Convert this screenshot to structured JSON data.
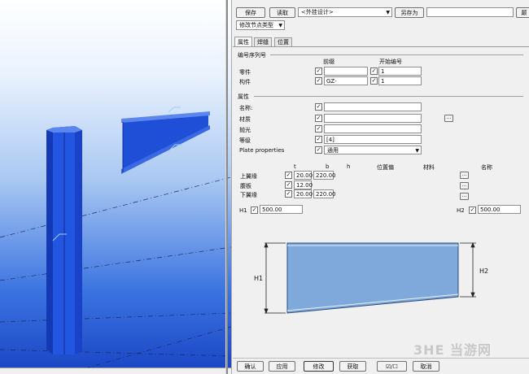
{
  "toolbar": {
    "save_label": "保存",
    "read_label": "读取",
    "preset_value": "<外挂设计>",
    "save_as_label": "另存为",
    "saveas_name_value": "",
    "third_button_label": "颠"
  },
  "mode_select": {
    "value": "修改节点类型"
  },
  "tabs": [
    {
      "label": "属性",
      "active": true
    },
    {
      "label": "焊缝",
      "active": false
    },
    {
      "label": "位置",
      "active": false
    }
  ],
  "numbering": {
    "section_title": "编号序列号",
    "prefix_header": "前缀",
    "start_header": "开始编号",
    "rows": [
      {
        "label": "零件",
        "prefix": "",
        "start": "1"
      },
      {
        "label": "构件",
        "prefix": "GZ-",
        "start": "1"
      }
    ]
  },
  "attributes": {
    "section_title": "属性",
    "rows": [
      {
        "label": "名称:",
        "value": ""
      },
      {
        "label": "材质",
        "value": ""
      },
      {
        "label": "抛光",
        "value": ""
      },
      {
        "label": "等级",
        "value": "[4]"
      },
      {
        "label": "Plate properties",
        "value": "通用"
      }
    ]
  },
  "profile": {
    "headers": {
      "t": "t",
      "b": "b",
      "h": "h",
      "offset": "位置偏",
      "material": "材料",
      "name": "名称"
    },
    "rows": [
      {
        "label": "上翼缘",
        "t": "20.00",
        "b": "220.00"
      },
      {
        "label": "腹板",
        "t": "12.00",
        "b": ""
      },
      {
        "label": "下翼缘",
        "t": "20.00",
        "b": "220.00"
      }
    ],
    "h1_label": "H1",
    "h1_value": "500.00",
    "h2_label": "H2",
    "h2_value": "500.00"
  },
  "diagram": {
    "h1_label": "H1",
    "h2_label": "H2"
  },
  "bottom_buttons": {
    "ok": "确认",
    "apply": "应用",
    "modify": "修改",
    "get": "获取",
    "toggle": "☑/☐",
    "cancel": "取消"
  },
  "watermark": "3HE 当游网",
  "colors": {
    "beam_blue": "#1f4fd6",
    "plate_fill": "#7fa9db"
  }
}
